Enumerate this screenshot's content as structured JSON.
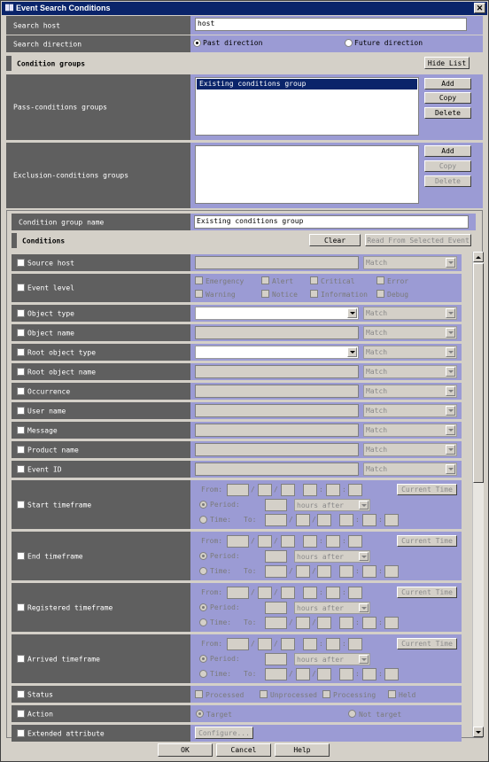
{
  "window": {
    "title": "Event Search Conditions",
    "close_glyph": "✕"
  },
  "search_host": {
    "label": "Search host",
    "value": "host"
  },
  "search_direction": {
    "label": "Search direction",
    "past": "Past direction",
    "future": "Future direction",
    "selected": "past"
  },
  "condition_groups": {
    "header": "Condition groups",
    "hide_list": "Hide List",
    "pass_label": "Pass-conditions groups",
    "pass_items": [
      "Existing conditions group"
    ],
    "exclusion_label": "Exclusion-conditions groups",
    "buttons": {
      "add": "Add",
      "copy": "Copy",
      "delete": "Delete"
    }
  },
  "group_name": {
    "label": "Condition group name",
    "value": "Existing conditions group"
  },
  "conditions": {
    "header": "Conditions",
    "clear": "Clear",
    "read_from_selected": "Read From Selected Event",
    "match": "Match",
    "rows": {
      "source_host": "Source host",
      "event_level": "Event level",
      "object_type": "Object type",
      "object_name": "Object name",
      "root_object_type": "Root object type",
      "root_object_name": "Root object name",
      "occurrence": "Occurrence",
      "user_name": "User name",
      "message": "Message",
      "product_name": "Product name",
      "event_id": "Event ID",
      "start_timeframe": "Start timeframe",
      "end_timeframe": "End timeframe",
      "registered_timeframe": "Registered timeframe",
      "arrived_timeframe": "Arrived timeframe",
      "status": "Status",
      "action": "Action",
      "extended_attribute": "Extended attribute"
    },
    "levels": [
      "Emergency",
      "Alert",
      "Critical",
      "Error",
      "Warning",
      "Notice",
      "Information",
      "Debug"
    ],
    "timeframe": {
      "from": "From:",
      "period": "Period:",
      "time": "Time:",
      "to": "To:",
      "hours_after": "hours after",
      "current_time": "Current Time",
      "slash": "/",
      "colon": ":"
    },
    "status_opts": [
      "Processed",
      "Unprocessed",
      "Processing",
      "Held"
    ],
    "action_opts": {
      "target": "Target",
      "not_target": "Not target"
    },
    "configure": "Configure..."
  },
  "footer": {
    "ok": "OK",
    "cancel": "Cancel",
    "help": "Help"
  }
}
